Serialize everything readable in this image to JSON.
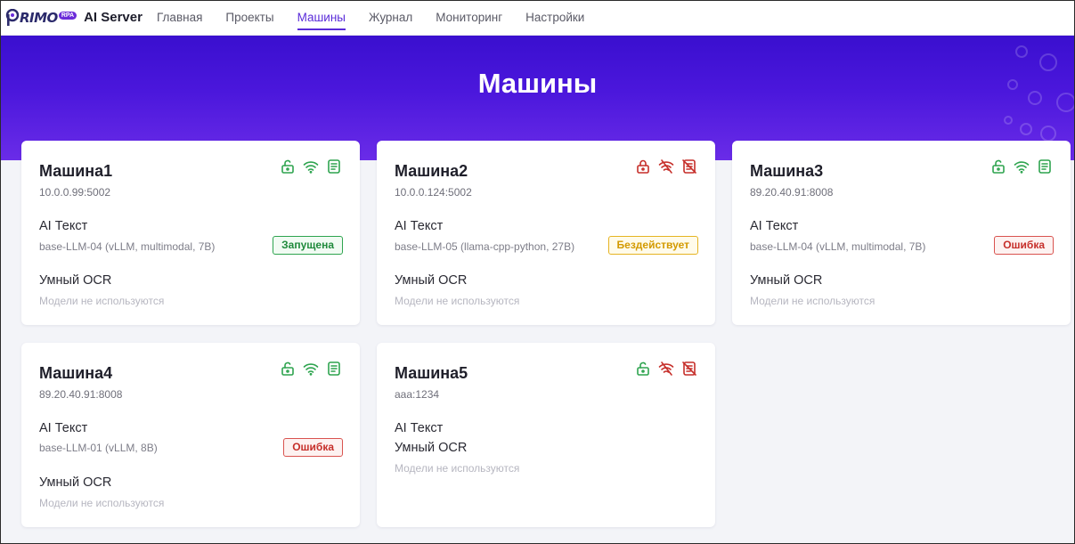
{
  "app": {
    "logo_text": "RIMO",
    "logo_badge": "RPA",
    "title": "AI Server"
  },
  "nav": [
    {
      "label": "Главная"
    },
    {
      "label": "Проекты"
    },
    {
      "label": "Машины",
      "active": true
    },
    {
      "label": "Журнал"
    },
    {
      "label": "Мониторинг"
    },
    {
      "label": "Настройки"
    }
  ],
  "page": {
    "title": "Машины"
  },
  "colors": {
    "accent": "#5a2bd9",
    "ok": "#2ea44f",
    "error": "#c62f2a",
    "warn": "#e6b422"
  },
  "machines": [
    {
      "name": "Машина1",
      "address": "10.0.0.99:5002",
      "icons": [
        {
          "name": "lock-open-icon",
          "status": "ok"
        },
        {
          "name": "wifi-icon",
          "status": "ok"
        },
        {
          "name": "document-icon",
          "status": "ok"
        }
      ],
      "ai_text_label": "AI Текст",
      "ai_text_model": "base-LLM-04 (vLLM, multimodal, 7B)",
      "ai_text_status": "Запущена",
      "ocr_label": "Умный OCR",
      "ocr_empty": "Модели не используются"
    },
    {
      "name": "Машина2",
      "address": "10.0.0.124:5002",
      "icons": [
        {
          "name": "lock-icon",
          "status": "error"
        },
        {
          "name": "wifi-off-icon",
          "status": "error"
        },
        {
          "name": "document-off-icon",
          "status": "error"
        }
      ],
      "ai_text_label": "AI Текст",
      "ai_text_model": "base-LLM-05 (llama-cpp-python, 27B)",
      "ai_text_status": "Бездействует",
      "ocr_label": "Умный OCR",
      "ocr_empty": "Модели не используются"
    },
    {
      "name": "Машина3",
      "address": "89.20.40.91:8008",
      "icons": [
        {
          "name": "lock-open-icon",
          "status": "ok"
        },
        {
          "name": "wifi-icon",
          "status": "ok"
        },
        {
          "name": "document-icon",
          "status": "ok"
        }
      ],
      "ai_text_label": "AI Текст",
      "ai_text_model": "base-LLM-04 (vLLM, multimodal, 7B)",
      "ai_text_status": "Ошибка",
      "ocr_label": "Умный OCR",
      "ocr_empty": "Модели не используются"
    },
    {
      "name": "Машина4",
      "address": "89.20.40.91:8008",
      "icons": [
        {
          "name": "lock-open-icon",
          "status": "ok"
        },
        {
          "name": "wifi-icon",
          "status": "ok"
        },
        {
          "name": "document-icon",
          "status": "ok"
        }
      ],
      "ai_text_label": "AI Текст",
      "ai_text_model": "base-LLM-01 (vLLM, 8B)",
      "ai_text_status": "Ошибка",
      "ocr_label": "Умный OCR",
      "ocr_empty": "Модели не используются"
    },
    {
      "name": "Машина5",
      "address": "aaa:1234",
      "icons": [
        {
          "name": "lock-open-icon",
          "status": "ok"
        },
        {
          "name": "wifi-off-icon",
          "status": "error"
        },
        {
          "name": "document-off-icon",
          "status": "error"
        }
      ],
      "ai_text_label": "AI Текст",
      "ocr_label": "Умный OCR",
      "ocr_empty": "Модели не используются"
    }
  ]
}
